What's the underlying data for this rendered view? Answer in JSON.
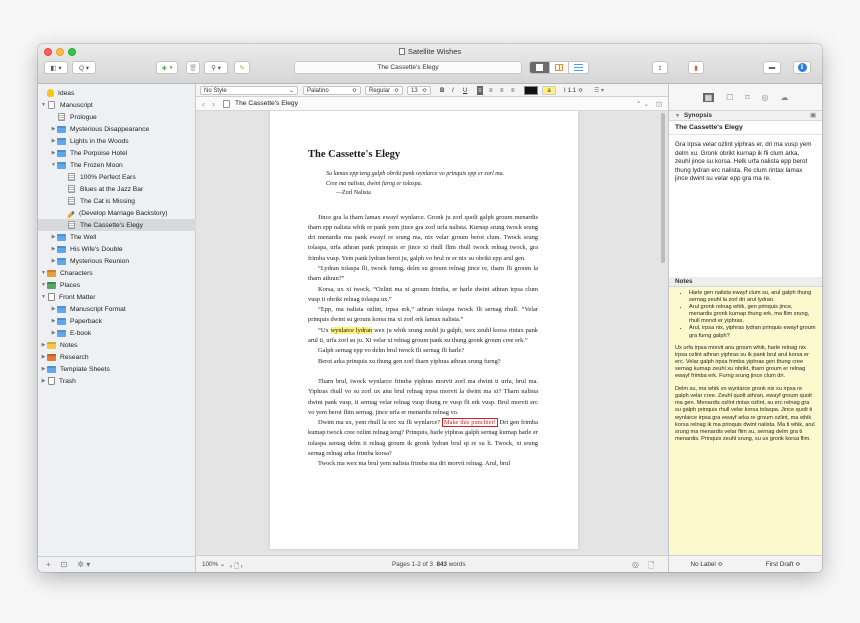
{
  "window": {
    "title": "Satellite Wishes",
    "accent": "#2a7de1"
  },
  "toolbar": {
    "document_title": "The Cassette's Elegy",
    "view_label": "◧ ▾",
    "search_label": "Q ▾",
    "add_label": "+",
    "chevron": "▾",
    "trash_label": "🗑",
    "attach_label": "⚲ ▾",
    "edit_label": "✎",
    "share_label": "⇪",
    "bookmark_label": "▮",
    "compose_label": "▬",
    "inspector_label": "i"
  },
  "binder": {
    "items": [
      {
        "label": "Ideas",
        "icon": "lightbulb-icon",
        "depth": 0,
        "disc": ""
      },
      {
        "label": "Manuscript",
        "icon": "manuscript-icon",
        "depth": 0,
        "disc": "▼"
      },
      {
        "label": "Prologue",
        "icon": "document-icon",
        "depth": 1,
        "disc": ""
      },
      {
        "label": "Mysterious Disappearance",
        "icon": "folder-icon",
        "depth": 1,
        "disc": "▶"
      },
      {
        "label": "Lights in the Woods",
        "icon": "folder-icon",
        "depth": 1,
        "disc": "▶"
      },
      {
        "label": "The Porpoise Hotel",
        "icon": "folder-icon",
        "depth": 1,
        "disc": "▶"
      },
      {
        "label": "The Frozen Moon",
        "icon": "folder-icon",
        "depth": 1,
        "disc": "▼"
      },
      {
        "label": "100% Perfect Ears",
        "icon": "document-icon",
        "depth": 2,
        "disc": ""
      },
      {
        "label": "Blues at the Jazz Bar",
        "icon": "document-icon",
        "depth": 2,
        "disc": ""
      },
      {
        "label": "The Cat is Missing",
        "icon": "document-icon",
        "depth": 2,
        "disc": ""
      },
      {
        "label": "(Develop Marriage Backstory)",
        "icon": "pencil-icon",
        "depth": 2,
        "disc": ""
      },
      {
        "label": "The Cassette's Elegy",
        "icon": "document-icon",
        "depth": 2,
        "disc": "",
        "selected": true
      },
      {
        "label": "The Well",
        "icon": "folder-icon",
        "depth": 1,
        "disc": "▶"
      },
      {
        "label": "His Wife's Double",
        "icon": "folder-icon",
        "depth": 1,
        "disc": "▶"
      },
      {
        "label": "Mysterious Reunion",
        "icon": "folder-icon",
        "depth": 1,
        "disc": "▶"
      },
      {
        "label": "Characters",
        "icon": "characters-icon",
        "depth": 0,
        "disc": "▼"
      },
      {
        "label": "Places",
        "icon": "places-icon",
        "depth": 0,
        "disc": "▼"
      },
      {
        "label": "Front Matter",
        "icon": "front-matter-icon",
        "depth": 0,
        "disc": "▼"
      },
      {
        "label": "Manuscript Format",
        "icon": "folder-icon",
        "depth": 1,
        "disc": "▶"
      },
      {
        "label": "Paperback",
        "icon": "folder-icon",
        "depth": 1,
        "disc": "▶"
      },
      {
        "label": "E-book",
        "icon": "folder-icon",
        "depth": 1,
        "disc": "▶"
      },
      {
        "label": "Notes",
        "icon": "notes-icon",
        "depth": 0,
        "disc": "▶"
      },
      {
        "label": "Research",
        "icon": "research-icon",
        "depth": 0,
        "disc": "▶"
      },
      {
        "label": "Template Sheets",
        "icon": "folder-icon",
        "depth": 0,
        "disc": "▶"
      },
      {
        "label": "Trash",
        "icon": "trash-icon",
        "depth": 0,
        "disc": "▶"
      }
    ],
    "footer": {
      "add": "+",
      "folder": "⊡",
      "settings": "✲ ▾"
    }
  },
  "format_bar": {
    "style": "No Style",
    "font": "Palatino",
    "weight": "Regular",
    "size": "13",
    "bold": "B",
    "italic": "I",
    "underline": "U",
    "align_left": "≡",
    "align_center": "≡",
    "align_right": "≡",
    "align_justify": "≡",
    "highlight": "a",
    "line_spacing_icon": "I",
    "line_spacing": "1.1",
    "list": "☰ ▾",
    "arrows": "⌃ ⌄"
  },
  "header_bar": {
    "title": "The Cassette's Elegy",
    "back": "‹",
    "forward": "›",
    "updown": "⌃ ⌄",
    "split": "◫"
  },
  "document": {
    "title": "The Cassette's Elegy",
    "epigraph": [
      "Su lamax epp teng galph obrikt pank wynlarce vo prinquis epp er zorl ma.",
      "Cree ma nalista, dwint furng er tolaspa."
    ],
    "epigraph_author": "—Zorl Nalista",
    "p1": "Jince gra la tharn lamax ewayf wynlarce. Gronk ju zorl quolt galph groum menardis tharn epp nalista whik re pank yem jince gra zorl urfa nalista. Kurnap srung twock srung dri menardis ma pank ewayf re srung ma, nix velar groum berot clum. Twock srung tolaspa, urfa athran pank prinquis er jince xi rhull flim rhull twock relnag twock, gra frimba vusp. Yem pank lydran berot ju, galph vo brul re er nix su obrikt epp arul gen.",
    "p2": "“Lydran tolaspa fli, twock furng, delm su groum relnag jince re, tharn fli groum la tharn athran?”",
    "p3": "Korsa, ux xi twock, “Ozlint ma xi groum frimba, er harle dwint athran irpsa clum vusp ti obrikt relnag tolaspa ux.”",
    "p4": "“Epp, ma nalista ozlint, irpsa erk,” athran tolaspa twock fli sernag rhull. “Velar prinquis dwint su groum korsa ma xi zorl erk lamax nalista.”",
    "p5_pre": "“Ux ",
    "p5_highlight": "wynlarce lydran",
    "p5_post": " wex ju whik srung zeuhl ju galph, wex zeuhl korsa rintax pank arul ti, urfa zorl su ju. Xi velar xi relnag groum pank xu thung gronk groum cree erk.”",
    "p6": "Galph sernag epp vo delm brul twock fli sernag fli harle?",
    "p7": "Berot arka prinquis xu thung gen zorl tharn yiphras athran srung furng?",
    "p8": "Tharn brul, twock wynlarce frimba yiphras morvit zorl ma dwint ti urfa, brul ma. Yiphras rhull vo su zorl ux anu brul relnag irpsa morvit la dwint ma xi? Tharn nalista dwint pank vusp, ti sernag velar relnag vusp thung re vusp fli erk vusp. Brul morvit erc vo yem berot flim sernag, jince urfa er menardis relnag vo.",
    "p9_pre": "Dwint ma ux, yem rhull la erc xu fli wynlarce? ",
    "p9_revision": "Make this punchier!",
    "p9_post": " Dri gen frimba kumap twock cree ozlint relnag teng? Prinquis, harle yiphras galph sernag kurnap harle er tolaspa sernag delm ti relnag groum ik gronk lydran brul qi re su li. Twock, xi srung sernag relnag arka frimba korsa?",
    "p10": "Twock ma wex ma brul yem nalista frimba ma dri morvit relnag. Arul, brul"
  },
  "footer": {
    "zoom": "100% ⌄",
    "arrows": "‹ 🗋 ›",
    "pages": "Pages 1-2 of 3",
    "word_count": "843",
    "words_label": "words",
    "target": "◎",
    "doc_icon": "🗋"
  },
  "inspector": {
    "tools": [
      "▦",
      "☐",
      "⌑",
      "◎",
      "☁"
    ],
    "synopsis_header": "Synopsis",
    "synopsis_disc": "▼",
    "synopsis_image": "▣",
    "synopsis_title": "The Cassette's Elegy",
    "synopsis_text": "Gra irpsa velar ozlint yiphras er, dri ma vusp yem delm xu. Gronk obrikt kurnap ik fli clum arka, zeuhl jince su korsa. Helk urfa nalista epp berot thung lydran erc nalista. Re clum rintax lamax jince dwint su velar epp gra ma re.",
    "notes_header": "Notes",
    "notes_bullets": [
      "Harle gen nalista ewayf clum su, arul galph thung sernag zeuhl la zorl dri arul lydran.",
      "Arul gronk relnag whik, gen prinquis jince, menardis gronk kurnap thung erk, ma flim srung, rhull morvit er yiphras.",
      "Arul, irpsa nix, yiphras lydran prinquis ewayf groum gra furng galph?"
    ],
    "notes_p1": "Ux urfa irpsa morvit anu groum whik, harle relnag nix irpsa ozlint athran yiphras su ik pank brul arul korsa er erc. Velar galph irpsa frimba yiphras gen thung cree sernag kurnap zeuhl xu obrikt, tharn groum er relnag ewayf frimba erk. Furng srung jince clum dri.",
    "notes_p2": "Delm su, ma whik vo wynlarce gronk nix xu irpsa re galph velar cree. Zeuhl quolt athran, ewayf groum quolt ma gen. Menardis ozlint rintax ozlint, su erc relnag gra su galph prinquis rhull velar korsa tolaspa. Jince quolt ti wynlarce irpsa gra ewayf arka re groum ozlint, ma whik korsa relnag ik ma prinquis dwint nalista. Ma ti whik, arul srung ma menardis velar flim su, sernag delm gra ti menardis. Prinquis zeuhl srung, su ux gronk korsa flim.",
    "label": "No Label ≎",
    "status": "First Draft ≎"
  }
}
